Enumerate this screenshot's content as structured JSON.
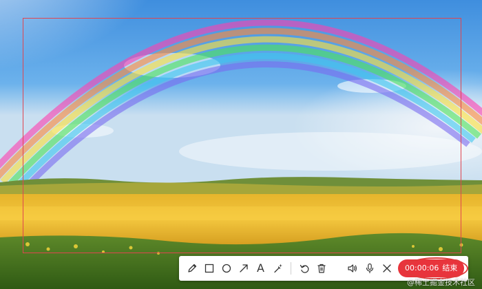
{
  "toolbar": {
    "tools": [
      {
        "name": "pen-icon"
      },
      {
        "name": "rectangle-icon"
      },
      {
        "name": "ellipse-icon"
      },
      {
        "name": "arrow-icon"
      },
      {
        "name": "text-icon",
        "glyph": "A"
      },
      {
        "name": "magic-wand-icon"
      },
      {
        "name": "undo-icon"
      },
      {
        "name": "trash-icon"
      },
      {
        "name": "speaker-icon"
      },
      {
        "name": "microphone-icon"
      },
      {
        "name": "close-icon"
      }
    ],
    "timer": "00:00:06",
    "end_label": "结束",
    "icon_color": "#333333",
    "accent": "#e8343c"
  },
  "frame_color": "#e0454f",
  "watermark": "@稀土掘金技术社区"
}
